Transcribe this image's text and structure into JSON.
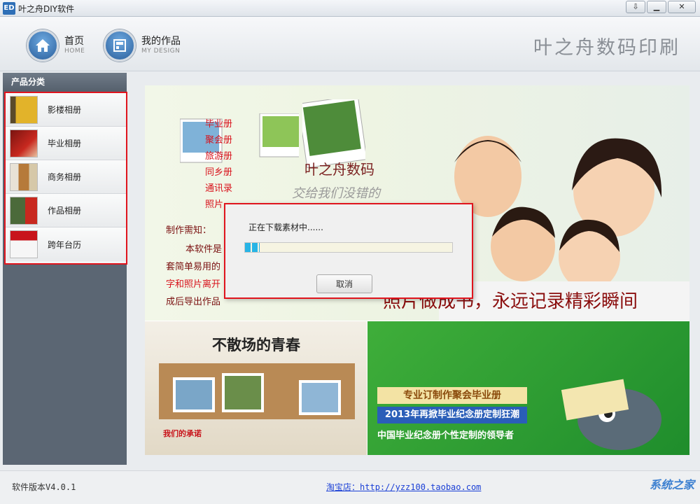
{
  "window": {
    "title": "叶之舟DIY软件",
    "icon_text": "ED",
    "buttons": [
      "⇩",
      "▁",
      "✕"
    ]
  },
  "header": {
    "nav": [
      {
        "cn": "首页",
        "en": "HOME"
      },
      {
        "cn": "我的作品",
        "en": "MY DESIGN"
      }
    ],
    "brand": "叶之舟数码印刷"
  },
  "sidebar": {
    "title": "产品分类",
    "items": [
      {
        "label": "影楼相册",
        "color": "#e2b32a"
      },
      {
        "label": "毕业相册",
        "color": "#c8281f"
      },
      {
        "label": "商务相册",
        "color": "#b67a3a"
      },
      {
        "label": "作品相册",
        "color": "#4b6a3a"
      },
      {
        "label": "跨年台历",
        "color": "#c8141b"
      }
    ]
  },
  "banner": {
    "links": [
      "毕业册",
      "聚会册",
      "旅游册",
      "同乡册",
      "通讯录",
      "照片"
    ],
    "brand_art": "叶之舟数码",
    "brand_art_sub": "交给我们没错的",
    "notice_title": "制作需知：",
    "notice_lines": [
      "本软件是",
      "套简单易用的",
      "字和照片离开",
      "成后导出作品"
    ],
    "slogan": "照片做成书，永远记录精彩瞬间",
    "bottom_left_title": "不散场的青春",
    "bottom_left_caption": "我们的承诺",
    "bottom_right_1": "专业订制作聚会毕业册",
    "bottom_right_2": "2013年再掀毕业纪念册定制狂潮",
    "bottom_right_3": "中国毕业纪念册个性定制的领导者"
  },
  "dialog": {
    "message": "正在下载素材中......",
    "progress": 0.07,
    "cancel_label": "取消"
  },
  "footer": {
    "version": "软件版本V4.0.1",
    "shop_label": "淘宝店：",
    "shop_url": "http://yzz100.taobao.com",
    "watermark": "系统之家"
  }
}
